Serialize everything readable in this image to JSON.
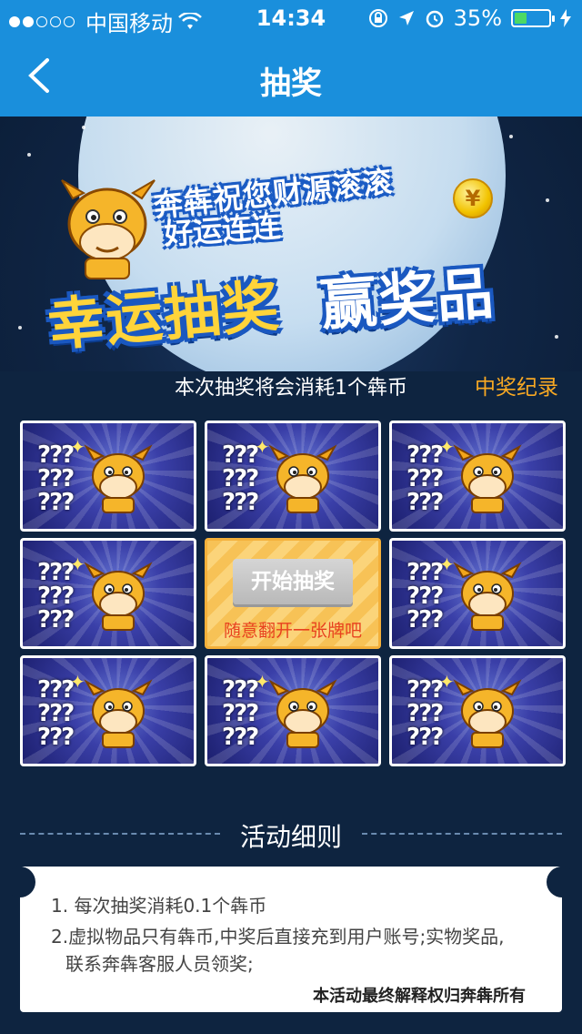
{
  "status_bar": {
    "carrier": "中国移动",
    "time": "14:34",
    "battery_percent": "35%",
    "battery_level": 0.35,
    "signal_dots_filled": 2,
    "signal_dots_total": 5
  },
  "nav": {
    "title": "抽奖",
    "back_icon": "chevron-left-icon"
  },
  "banner": {
    "line1": "奔犇祝您财源滚滚",
    "line2": "好运连连",
    "big_yellow": "幸运抽奖",
    "big_white": "赢奖品",
    "coin_symbol": "¥"
  },
  "info": {
    "cost_text": "本次抽奖将会消耗1个犇币",
    "history_link": "中奖纪录"
  },
  "grid": {
    "question_marks": "???",
    "center": {
      "button": "开始抽奖",
      "hint": "随意翻开一张牌吧"
    }
  },
  "rules": {
    "title": "活动细则",
    "items": [
      "1. 每次抽奖消耗0.1个犇币",
      "2.虚拟物品只有犇币,中奖后直接充到用户账号;实物奖品,",
      "联系奔犇客服人员领奖;"
    ],
    "footer": "本活动最终解释权归奔犇所有"
  },
  "colors": {
    "nav_blue": "#1a8fdc",
    "accent_orange": "#f7a823",
    "hint_red": "#e8421f",
    "background": "#0e2440"
  }
}
